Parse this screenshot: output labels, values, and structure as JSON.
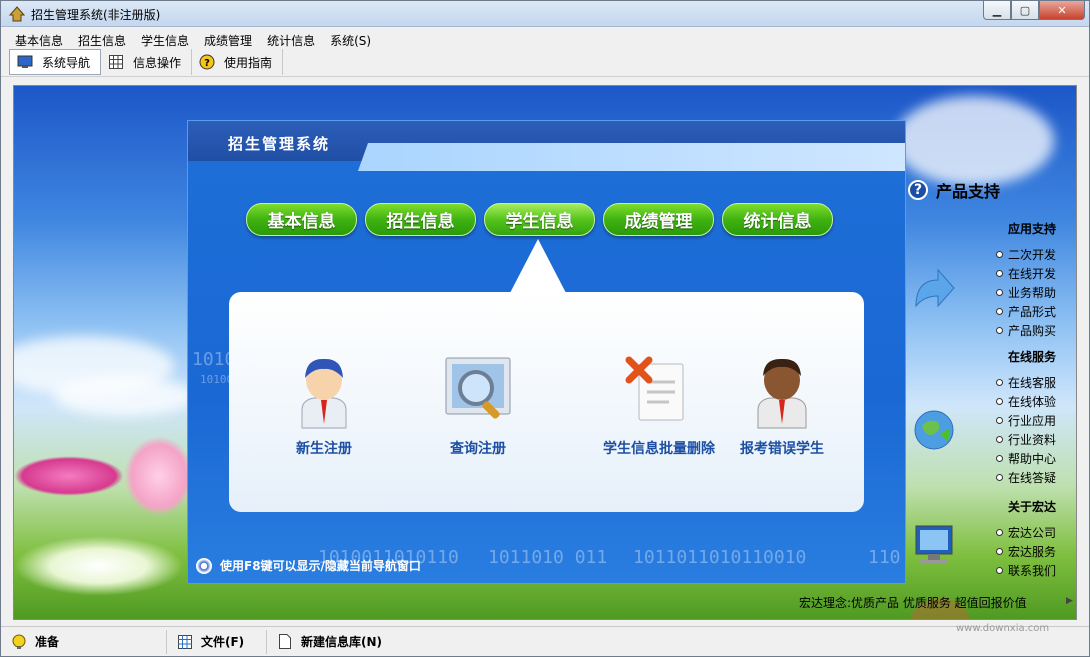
{
  "window": {
    "title": "招生管理系统(非注册版)"
  },
  "menubar": {
    "items": [
      "基本信息",
      "招生信息",
      "学生信息",
      "成绩管理",
      "统计信息",
      "系统(S)"
    ]
  },
  "toolbar": {
    "buttons": [
      {
        "label": "系统导航",
        "icon": "monitor-icon",
        "active": true
      },
      {
        "label": "信息操作",
        "icon": "grid-icon",
        "active": false
      },
      {
        "label": "使用指南",
        "icon": "help-icon",
        "active": false
      }
    ]
  },
  "panel": {
    "title": "招生管理系统",
    "tabs": [
      "基本信息",
      "招生信息",
      "学生信息",
      "成绩管理",
      "统计信息"
    ],
    "active_tab": "学生信息",
    "functions": [
      {
        "label": "新生注册",
        "icon": "student-icon"
      },
      {
        "label": "查询注册",
        "icon": "search-magnifier-icon"
      },
      {
        "label": "学生信息批量删除",
        "icon": "delete-document-icon"
      },
      {
        "label": "报考错误学生",
        "icon": "student-brown-icon"
      }
    ],
    "footer": "使用F8键可以显示/隐藏当前导航窗口",
    "binary_text": [
      "1010",
      "10100",
      "1010011010110",
      "1011010 011",
      "1011011010110010",
      "110"
    ]
  },
  "support": {
    "title": "产品支持",
    "groups": [
      {
        "title": "应用支持",
        "items": [
          "二次开发",
          "在线开发",
          "业务帮助",
          "产品形式",
          "产品购买"
        ]
      },
      {
        "title": "在线服务",
        "items": [
          "在线客服",
          "在线体验",
          "行业应用",
          "行业资料",
          "帮助中心",
          "在线答疑"
        ]
      },
      {
        "title": "关于宏达",
        "items": [
          "宏达公司",
          "宏达服务",
          "联系我们"
        ]
      }
    ]
  },
  "bottom_text": "宏达理念:优质产品  优质服务  超值回报价值",
  "statusbar": {
    "cells": [
      {
        "label": "准备",
        "icon": "bulb-icon"
      },
      {
        "label": "文件(F)",
        "icon": "table-icon"
      },
      {
        "label": "新建信息库(N)",
        "icon": "document-icon"
      }
    ]
  },
  "watermark": "www.downxia.com"
}
